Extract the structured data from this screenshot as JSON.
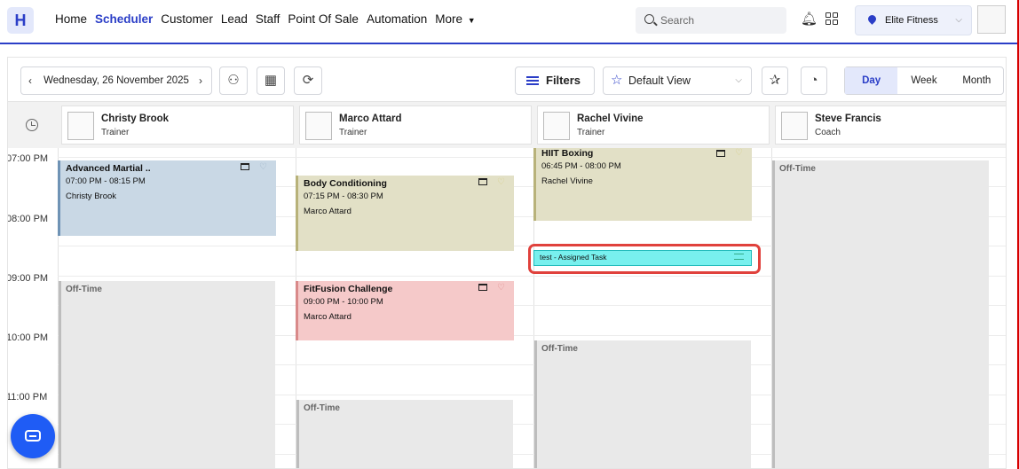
{
  "nav": {
    "logo": "H",
    "items": [
      {
        "label": "Home",
        "active": false
      },
      {
        "label": "Scheduler",
        "active": true
      },
      {
        "label": "Customer",
        "active": false
      },
      {
        "label": "Lead",
        "active": false
      },
      {
        "label": "Staff",
        "active": false
      },
      {
        "label": "Point Of Sale",
        "active": false
      },
      {
        "label": "Automation",
        "active": false
      },
      {
        "label": "More",
        "active": false
      }
    ],
    "search_placeholder": "Search",
    "location": "Elite Fitness",
    "brand_color": "#2b3ec7"
  },
  "toolbar": {
    "date": "Wednesday, 26 November 2025",
    "filters_label": "Filters",
    "view_label": "Default View",
    "view_modes": [
      "Day",
      "Week",
      "Month"
    ],
    "active_view": "Day"
  },
  "resources": [
    {
      "name": "Christy Brook",
      "role": "Trainer"
    },
    {
      "name": "Marco Attard",
      "role": "Trainer"
    },
    {
      "name": "Rachel Vivine",
      "role": "Trainer"
    },
    {
      "name": "Steve Francis",
      "role": "Coach"
    }
  ],
  "time_labels": [
    "07:00 PM",
    "08:00 PM",
    "09:00 PM",
    "10:00 PM",
    "11:00 PM"
  ],
  "events": [
    {
      "title": "Advanced Martial ..",
      "time": "07:00 PM - 08:15 PM",
      "who": "Christy Brook",
      "color": "#c9d8e5",
      "border": "#6f93b5"
    },
    {
      "title": "Body Conditioning",
      "time": "07:15 PM - 08:30 PM",
      "who": "Marco Attard",
      "color": "#e2e0c6",
      "border": "#b8b27a"
    },
    {
      "title": "HIIT Boxing",
      "time": "06:45 PM - 08:00 PM",
      "who": "Rachel Vivine",
      "color": "#e2e0c6",
      "border": "#b8b27a"
    },
    {
      "title": "FitFusion Challenge",
      "time": "09:00 PM - 10:00 PM",
      "who": "Marco Attard",
      "color": "#f5c9c9",
      "border": "#d98a8a"
    }
  ],
  "offtime_label": "Off-Time",
  "task": {
    "label": "test - Assigned Task",
    "color": "#78f0ee"
  }
}
